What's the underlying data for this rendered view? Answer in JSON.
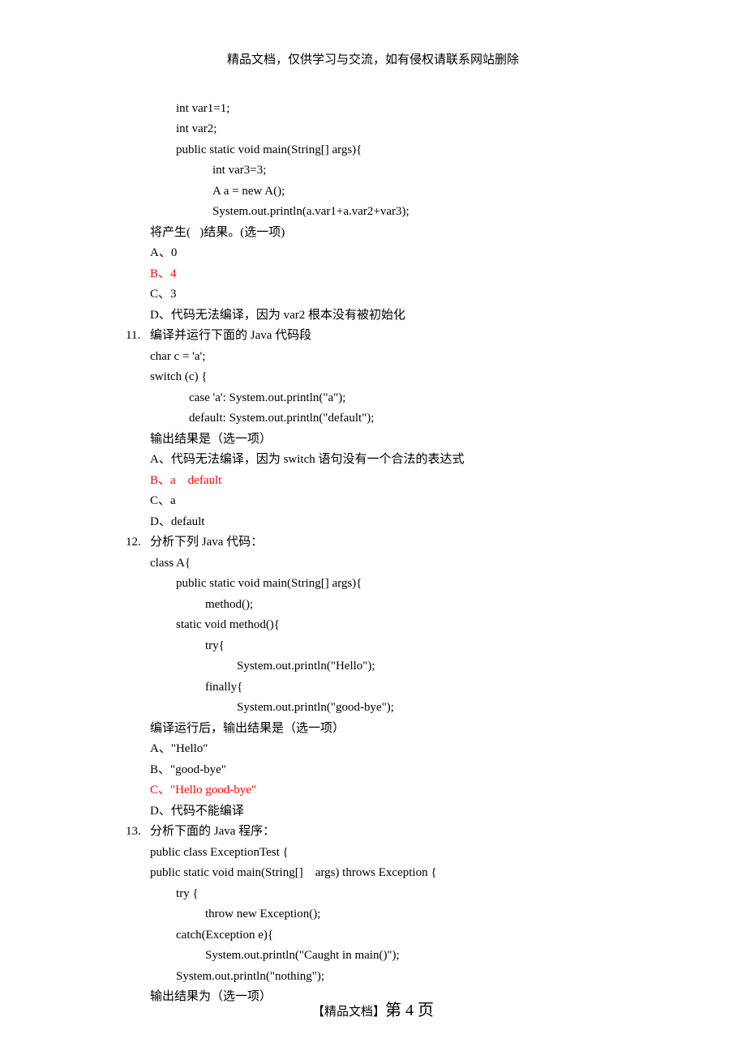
{
  "header": "精品文档，仅供学习与交流，如有侵权请联系网站删除",
  "q10": {
    "code": [
      "int var1=1;",
      "int var2;",
      "public static void main(String[] args){",
      "int var3=3;",
      "A a = new A();",
      "System.out.println(a.var1+a.var2+var3);"
    ],
    "prompt": "将产生(   )结果。(选一项)",
    "optA": "A、0",
    "optB": "B、4",
    "optC": "C、3",
    "optD": "D、代码无法编译，因为 var2 根本没有被初始化"
  },
  "q11": {
    "num": "11.",
    "title": "编译并运行下面的 Java 代码段",
    "code": [
      "char c = 'a';",
      "switch (c) {",
      "case 'a': System.out.println(\"a\");",
      "default: System.out.println(\"default\");"
    ],
    "prompt": "输出结果是（选一项）",
    "optA": "A、代码无法编译，因为 switch 语句没有一个合法的表达式",
    "optB": "B、a    default",
    "optC": "C、a",
    "optD": "D、default"
  },
  "q12": {
    "num": "12.",
    "title": "分析下列 Java 代码：",
    "code": [
      "class A{",
      "public static void main(String[] args){",
      "method();",
      "static void method(){",
      "try{",
      "System.out.println(\"Hello\");",
      "finally{",
      "System.out.println(\"good-bye\");"
    ],
    "prompt": "编译运行后，输出结果是（选一项）",
    "optA": "A、\"Hello\"",
    "optB": "B、\"good-bye\"",
    "optC": "C、\"Hello good-bye\"",
    "optD": "D、代码不能编译"
  },
  "q13": {
    "num": "13.",
    "title": "分析下面的 Java 程序：",
    "code": [
      "public class ExceptionTest {",
      "public static void main(String[]    args) throws Exception {",
      "try {",
      "throw new Exception();",
      "catch(Exception e){",
      "System.out.println(\"Caught in main()\");",
      "System.out.println(\"nothing\");"
    ],
    "prompt": "输出结果为（选一项）"
  },
  "footer": {
    "label": "【精品文档】",
    "page": "第 4 页"
  }
}
